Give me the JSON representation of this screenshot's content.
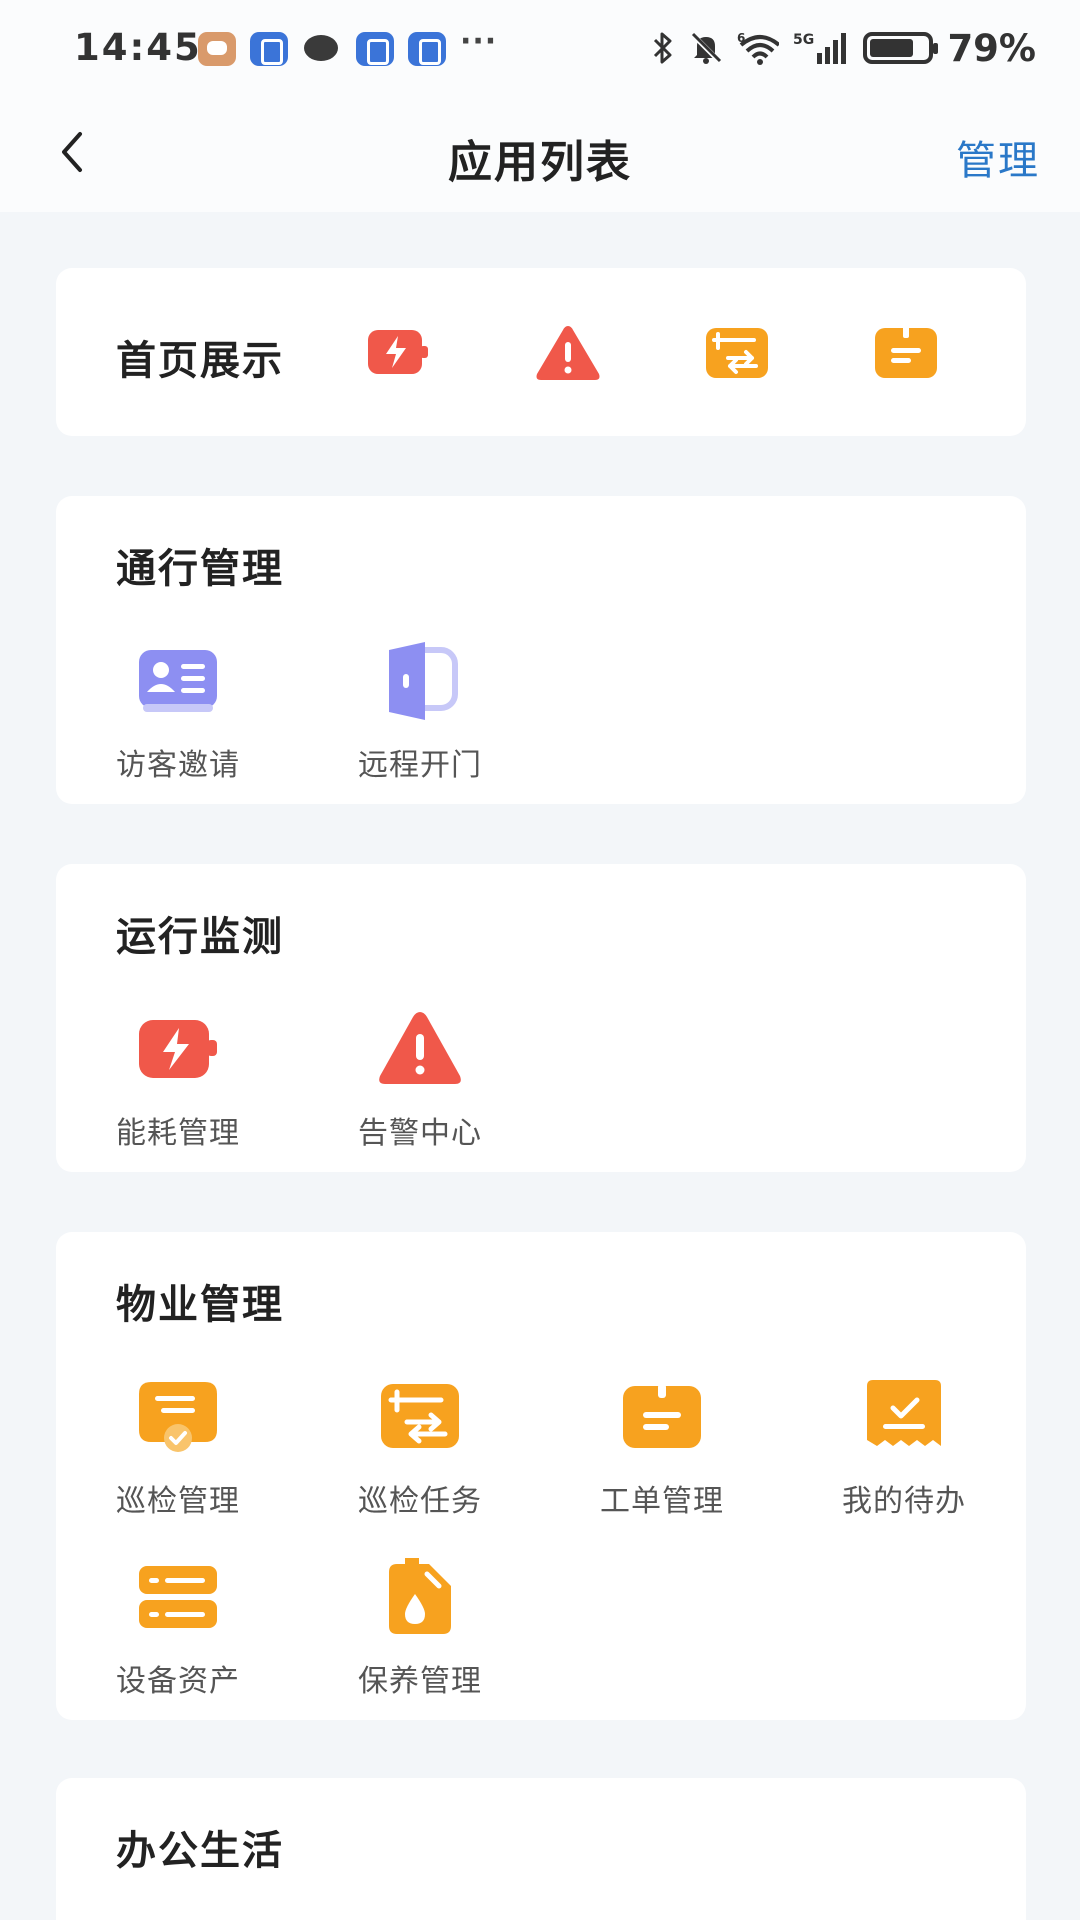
{
  "status_bar": {
    "time": "14:45",
    "notification_icons": [
      "message-app-icon",
      "blue-app-icon",
      "chat-bubble-icon",
      "blue-app-icon",
      "blue-app-icon"
    ],
    "overflow": "···",
    "network_label": "5G",
    "wifi_label": "6",
    "battery_percent": 79,
    "battery_text": "79%"
  },
  "header": {
    "back_icon": "chevron-left-icon",
    "title": "应用列表",
    "manage_label": "管理"
  },
  "home_display": {
    "title": "首页展示",
    "icons": [
      "energy-battery-icon",
      "warning-triangle-icon",
      "patrol-task-icon",
      "work-order-icon"
    ]
  },
  "sections": [
    {
      "title": "通行管理",
      "apps": [
        {
          "label": "访客邀请",
          "icon": "visitor-card-icon"
        },
        {
          "label": "远程开门",
          "icon": "door-icon"
        }
      ]
    },
    {
      "title": "运行监测",
      "apps": [
        {
          "label": "能耗管理",
          "icon": "energy-battery-icon"
        },
        {
          "label": "告警中心",
          "icon": "warning-triangle-icon"
        }
      ]
    },
    {
      "title": "物业管理",
      "apps": [
        {
          "label": "巡检管理",
          "icon": "inspection-icon"
        },
        {
          "label": "巡检任务",
          "icon": "patrol-task-icon"
        },
        {
          "label": "工单管理",
          "icon": "work-order-icon"
        },
        {
          "label": "我的待办",
          "icon": "todo-check-icon"
        },
        {
          "label": "设备资产",
          "icon": "device-asset-icon"
        },
        {
          "label": "保养管理",
          "icon": "maintenance-oil-icon"
        }
      ]
    },
    {
      "title": "办公生活",
      "apps": []
    }
  ],
  "colors": {
    "accent": "#2a78c8",
    "red": "#f0584a",
    "orange": "#f7a21f",
    "purple": "#8d8ff2",
    "background": "#f3f6f9"
  }
}
